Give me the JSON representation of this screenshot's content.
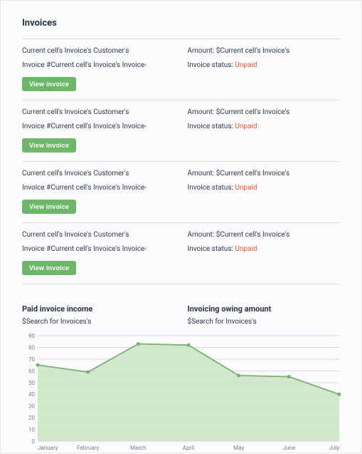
{
  "header": {
    "title": "Invoices"
  },
  "invoices": {
    "rows": [
      {
        "customer": "Current cell's Invoice's Customer's",
        "invoice_no": "Invoice #Current cell's Invoice's Invoice-",
        "amount": "Amount: $Current cell's Invoice's",
        "status_label": "Invoice status: ",
        "status_value": "Unpaid",
        "button": "View invoice"
      },
      {
        "customer": "Current cell's Invoice's Customer's",
        "invoice_no": "Invoice #Current cell's Invoice's Invoice-",
        "amount": "Amount: $Current cell's Invoice's",
        "status_label": "Invoice status: ",
        "status_value": "Unpaid",
        "button": "View invoice"
      },
      {
        "customer": "Current cell's Invoice's Customer's",
        "invoice_no": "Invoice #Current cell's Invoice's Invoice-",
        "amount": "Amount: $Current cell's Invoice's",
        "status_label": "Invoice status: ",
        "status_value": "Unpaid",
        "button": "View invoice"
      },
      {
        "customer": "Current cell's Invoice's Customer's",
        "invoice_no": "Invoice #Current cell's Invoice's Invoice-",
        "amount": "Amount: $Current cell's Invoice's",
        "status_label": "Invoice status: ",
        "status_value": "Unpaid",
        "button": "View invoice"
      }
    ]
  },
  "summary": {
    "left_title": "Paid invoice income",
    "left_value": "$Search for Invoices's",
    "right_title": "Invoicing owing amount",
    "right_value": "$Search for Invoices's"
  },
  "chart_data": {
    "type": "area",
    "categories": [
      "January",
      "February",
      "March",
      "April",
      "May",
      "June",
      "July"
    ],
    "values": [
      65,
      59,
      83,
      82,
      56,
      55,
      40
    ],
    "xlabel": "",
    "ylabel": "",
    "ylim": [
      0,
      90
    ],
    "y_ticks": [
      0,
      10,
      20,
      30,
      40,
      50,
      60,
      70,
      80,
      90
    ]
  }
}
